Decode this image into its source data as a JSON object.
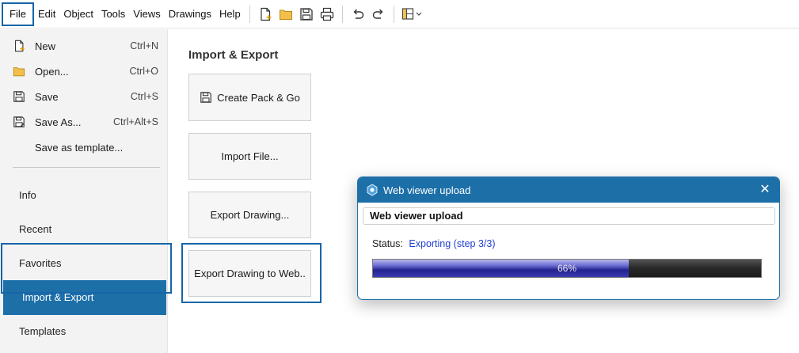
{
  "menubar": {
    "items": [
      "File",
      "Edit",
      "Object",
      "Tools",
      "Views",
      "Drawings",
      "Help"
    ]
  },
  "toolbar": {
    "icons": [
      "new-file-icon",
      "open-folder-icon",
      "save-icon",
      "print-icon",
      "undo-icon",
      "redo-icon",
      "layout-icon"
    ]
  },
  "backstage": {
    "commands": [
      {
        "label": "New",
        "shortcut": "Ctrl+N",
        "icon": "new-file-icon"
      },
      {
        "label": "Open...",
        "shortcut": "Ctrl+O",
        "icon": "open-folder-icon"
      },
      {
        "label": "Save",
        "shortcut": "Ctrl+S",
        "icon": "save-icon"
      },
      {
        "label": "Save As...",
        "shortcut": "Ctrl+Alt+S",
        "icon": "save-as-icon"
      },
      {
        "label": "Save as template...",
        "shortcut": "",
        "icon": ""
      }
    ],
    "nav": [
      "Info",
      "Recent",
      "Favorites",
      "Import & Export",
      "Templates"
    ],
    "active_nav": "Import & Export"
  },
  "main": {
    "title": "Import & Export",
    "buttons": [
      "Create Pack & Go",
      "Import File...",
      "Export Drawing...",
      "Export Drawing to Web.."
    ]
  },
  "dialog": {
    "title": "Web viewer upload",
    "header": "Web viewer upload",
    "status_label": "Status:",
    "status_value": "Exporting (step 3/3)",
    "progress_text": "66%",
    "progress_value": 0.66
  },
  "colors": {
    "accent": "#1d6fa8",
    "status_text": "#1f3fd1"
  }
}
